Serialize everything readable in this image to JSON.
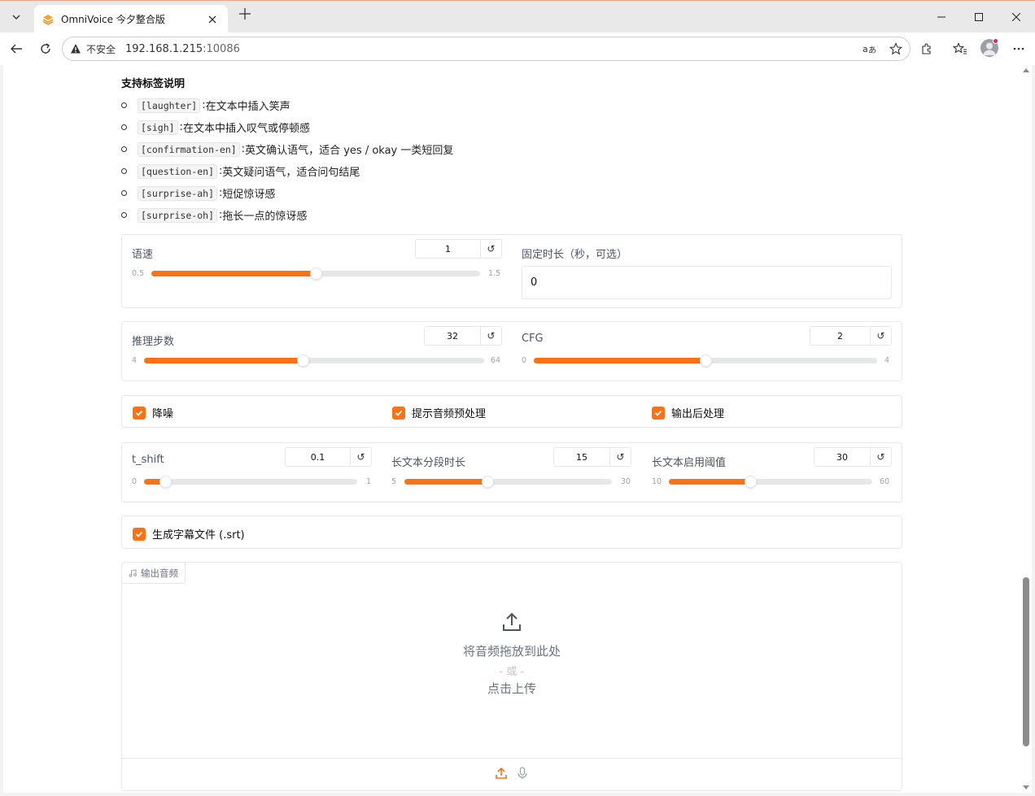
{
  "browser": {
    "tab_title": "OmniVoice 今夕整合版",
    "insecure_label": "不安全",
    "url_host": "192.168.1.215",
    "url_port": ":10086"
  },
  "tags": {
    "title": "支持标签说明",
    "items": [
      {
        "code": "[laughter]",
        "desc": "在文本中插入笑声"
      },
      {
        "code": "[sigh]",
        "desc": "在文本中插入叹气或停顿感"
      },
      {
        "code": "[confirmation-en]",
        "desc": "英文确认语气，适合 yes / okay 一类短回复"
      },
      {
        "code": "[question-en]",
        "desc": "英文疑问语气，适合问句结尾"
      },
      {
        "code": "[surprise-ah]",
        "desc": "短促惊讶感"
      },
      {
        "code": "[surprise-oh]",
        "desc": "拖长一点的惊讶感"
      }
    ]
  },
  "speed": {
    "label": "语速",
    "value": "1",
    "min": "0.5",
    "max": "1.5",
    "fraction": 0.5
  },
  "duration": {
    "label": "固定时长（秒，可选）",
    "value": "0"
  },
  "steps": {
    "label": "推理步数",
    "value": "32",
    "min": "4",
    "max": "64",
    "fraction": 0.467
  },
  "cfg": {
    "label": "CFG",
    "value": "2",
    "min": "0",
    "max": "4",
    "fraction": 0.5
  },
  "checks": {
    "denoise": "降噪",
    "preprocess": "提示音频预处理",
    "postprocess": "输出后处理"
  },
  "tshift": {
    "label": "t_shift",
    "value": "0.1",
    "min": "0",
    "max": "1",
    "fraction": 0.1
  },
  "segment": {
    "label": "长文本分段时长",
    "value": "15",
    "min": "5",
    "max": "30",
    "fraction": 0.4
  },
  "threshold": {
    "label": "长文本启用阈值",
    "value": "30",
    "min": "10",
    "max": "60",
    "fraction": 0.4
  },
  "srt": {
    "label": "生成字幕文件 (.srt)"
  },
  "output_audio": {
    "label": "输出音频",
    "drop_text": "将音频拖放到此处",
    "or_text": "- 或 -",
    "click_text": "点击上传"
  },
  "colors": {
    "accent": "#f97316",
    "border": "#e5e7eb"
  },
  "icons": [
    "chevron-down-icon",
    "close-icon",
    "plus-icon",
    "minimize-icon",
    "maximize-icon",
    "back-icon",
    "reload-icon",
    "warning-icon",
    "read-aloud-icon",
    "star-icon",
    "extensions-icon",
    "favorites-icon",
    "more-icon",
    "reset-icon",
    "check-icon",
    "music-icon",
    "upload-icon",
    "microphone-icon"
  ]
}
